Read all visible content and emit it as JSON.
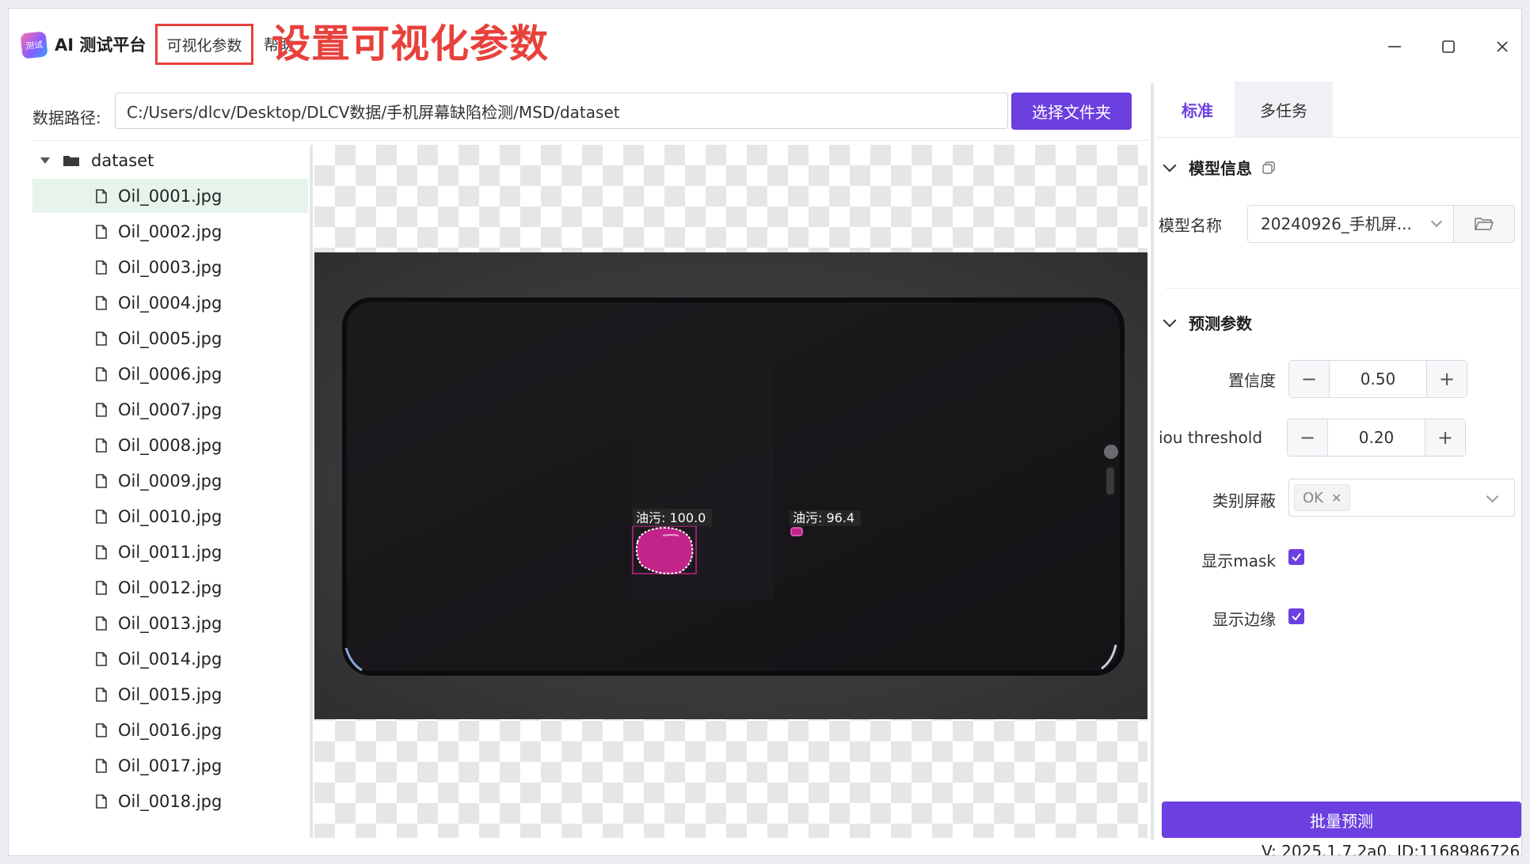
{
  "app": {
    "logo_text": "测试",
    "title": "AI 测试平台",
    "menu": [
      "可视化参数",
      "帮助"
    ],
    "annotation": "设置可视化参数"
  },
  "window_controls": {
    "minimize": "minimize-icon",
    "maximize": "maximize-icon",
    "close": "close-icon"
  },
  "data_path": {
    "label": "数据路径:",
    "value": "C:/Users/dlcv/Desktop/DLCV数据/手机屏幕缺陷检测/MSD/dataset",
    "button_label": "选择文件夹"
  },
  "file_tree": {
    "root": "dataset",
    "selected_index": 0,
    "files": [
      "Oil_0001.jpg",
      "Oil_0002.jpg",
      "Oil_0003.jpg",
      "Oil_0004.jpg",
      "Oil_0005.jpg",
      "Oil_0006.jpg",
      "Oil_0007.jpg",
      "Oil_0008.jpg",
      "Oil_0009.jpg",
      "Oil_0010.jpg",
      "Oil_0011.jpg",
      "Oil_0012.jpg",
      "Oil_0013.jpg",
      "Oil_0014.jpg",
      "Oil_0015.jpg",
      "Oil_0016.jpg",
      "Oil_0017.jpg",
      "Oil_0018.jpg"
    ]
  },
  "viewer": {
    "detections": [
      {
        "label": "油污: 100.0"
      },
      {
        "label": "油污: 96.4"
      }
    ],
    "mask_color": "#c2248a"
  },
  "right_panel": {
    "tabs": [
      {
        "label": "标准",
        "active": true
      },
      {
        "label": "多任务",
        "active": false
      }
    ],
    "model_info": {
      "title": "模型信息",
      "model_name_label": "模型名称",
      "model_name_value": "20240926_手机屏..."
    },
    "predict_params": {
      "title": "预测参数",
      "confidence_label": "置信度",
      "confidence_value": "0.50",
      "iou_label": "iou threshold",
      "iou_value": "0.20",
      "class_mask_label": "类别屏蔽",
      "class_mask_tag": "OK",
      "show_mask_label": "显示mask",
      "show_mask_checked": true,
      "show_edge_label": "显示边缘",
      "show_edge_checked": true
    },
    "batch_button_label": "批量预测",
    "version": "V: 2025.1.7.2a0, ID:1168986726"
  },
  "colors": {
    "accent": "#6b3fe0",
    "annotation": "#e8413c",
    "selected_row": "#e6f4ec"
  }
}
